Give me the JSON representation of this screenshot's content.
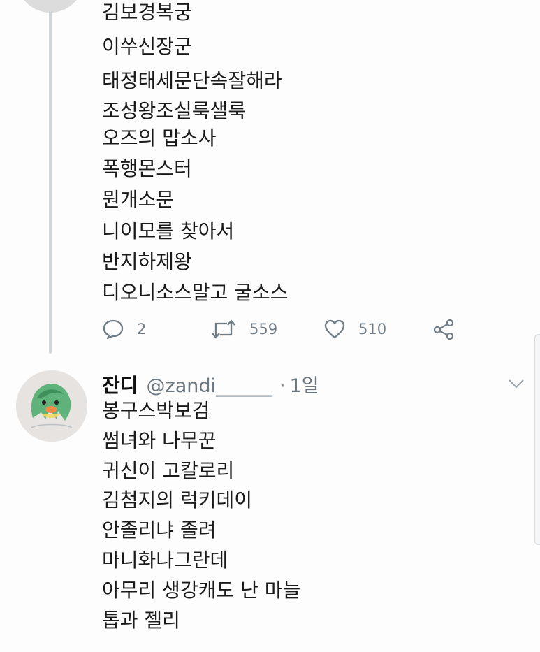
{
  "tweet1": {
    "lines": [
      "김보경복궁",
      "이쑤신장군",
      "태정태세문단속잘해라",
      "조성왕조실룩샐룩",
      "오즈의 맙소사",
      "폭행몬스터",
      "뭔개소문",
      "니이모를 찾아서",
      "반지하제왕",
      "디오니소스말고 굴소스"
    ],
    "actions": {
      "reply_count": "2",
      "retweet_count": "559",
      "like_count": "510"
    }
  },
  "tweet2": {
    "display_name": "잔디",
    "handle": "@zandi______",
    "separator": "·",
    "time": "1일",
    "avatar_text": "@zandi",
    "lines": [
      "봉구스박보검",
      "썸녀와 나무꾼",
      "귀신이 고칼로리",
      "김첨지의 럭키데이",
      "안졸리냐 졸려",
      "마니화나그란데",
      "아무리 생강캐도 난 마늘",
      "톱과 젤리"
    ]
  },
  "colors": {
    "text": "#1a1a1a",
    "muted": "#6d7780",
    "thread_line": "#cfd6dc",
    "icon": "#6f7b85"
  },
  "icons": [
    "reply-icon",
    "retweet-icon",
    "like-icon",
    "share-icon",
    "chevron-down-icon"
  ]
}
